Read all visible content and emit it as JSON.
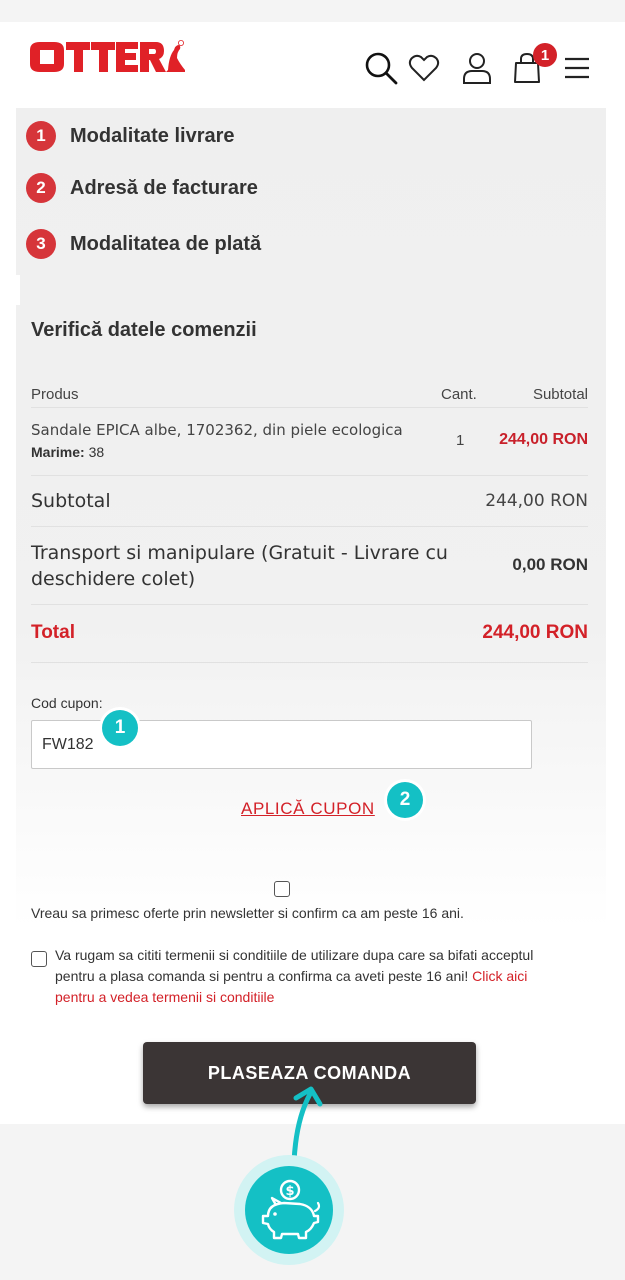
{
  "header": {
    "logo_text": "OTTER",
    "icons": [
      "search-icon",
      "heart-icon",
      "user-icon",
      "bag-icon",
      "menu-icon"
    ],
    "cart_count": "1"
  },
  "steps": [
    {
      "num": "1",
      "label": "Modalitate livrare"
    },
    {
      "num": "2",
      "label": "Adresă de facturare"
    },
    {
      "num": "3",
      "label": "Modalitatea de plată"
    }
  ],
  "review": {
    "title": "Verifică datele comenzii",
    "columns": {
      "product": "Produs",
      "qty": "Cant.",
      "subtotal": "Subtotal"
    },
    "item": {
      "name": "Sandale EPICA albe, 1702362, din piele ecologica",
      "size_label": "Marime:",
      "size_value": "38",
      "qty": "1",
      "price": "244,00 RON"
    },
    "subtotal": {
      "label": "Subtotal",
      "value": "244,00 RON"
    },
    "shipping": {
      "label": "Transport si manipulare (Gratuit - Livrare cu deschidere colet)",
      "value": "0,00 RON"
    },
    "total": {
      "label": "Total",
      "value": "244,00 RON"
    }
  },
  "coupon": {
    "label": "Cod cupon:",
    "value": "FW182",
    "apply_label": "APLICĂ CUPON",
    "badge_1": "1",
    "badge_2": "2"
  },
  "newsletter": {
    "text": "Vreau sa primesc oferte prin newsletter si confirm ca am peste 16 ani.",
    "checked": false
  },
  "terms": {
    "text": "Va rugam sa cititi termenii si conditiile de utilizare dupa care sa bifati acceptul pentru a plasa comanda si pentru a confirma ca aveti peste 16 ani! ",
    "link": "Click aici pentru a vedea termenii si conditiile",
    "checked": false
  },
  "place_order": {
    "label": "PLASEAZA COMANDA"
  },
  "colors": {
    "brand_red": "#d32128",
    "accent_teal": "#14c0c5",
    "button_dark": "#3b3535"
  }
}
